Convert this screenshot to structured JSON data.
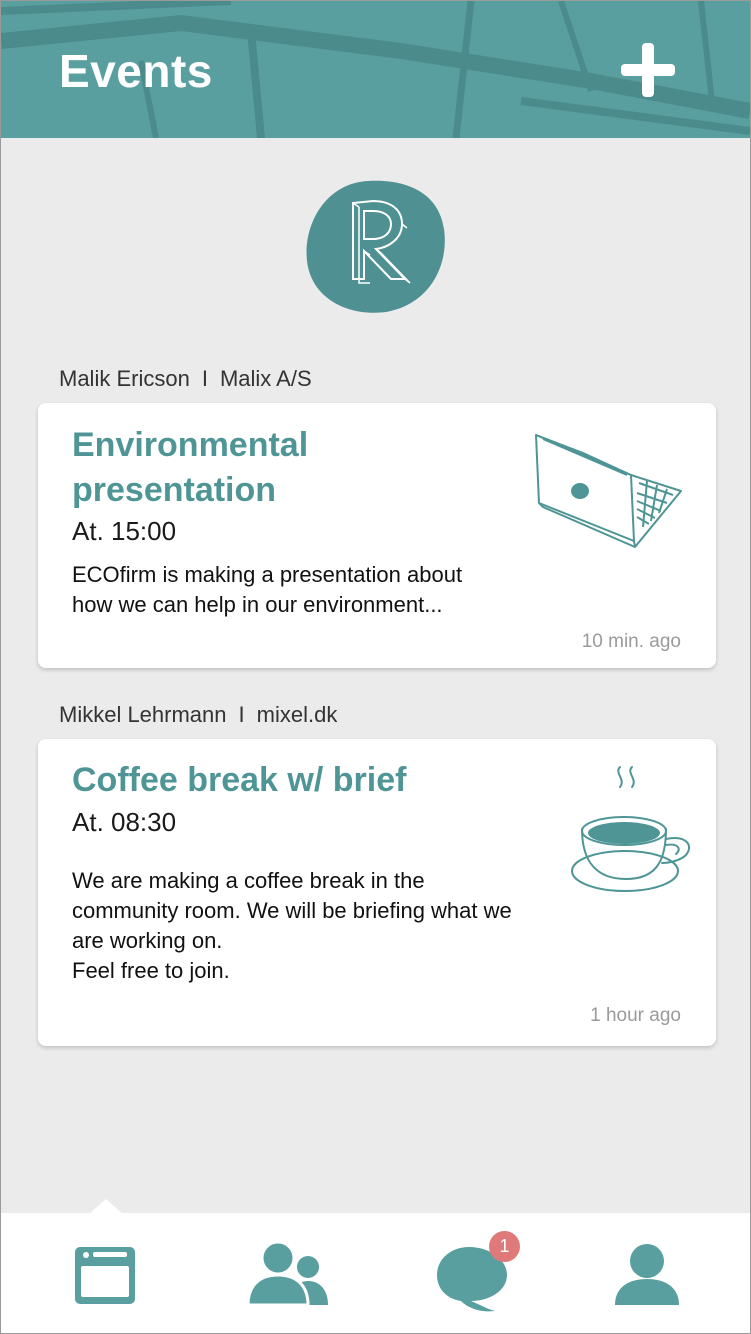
{
  "header": {
    "title": "Events",
    "add_icon": "plus-icon",
    "background": "#5a9fa0"
  },
  "logo": {
    "icon": "r-logo-icon",
    "color": "#4f9193"
  },
  "events": [
    {
      "author": "Malik Ericson",
      "separator": "I",
      "company": "Malix A/S",
      "title_line1": "Environmental",
      "title_line2": "presentation",
      "time": "At. 15:00",
      "description": "ECOfirm is making a presentation about\nhow we can help in our environment...",
      "ago": "10 min. ago",
      "icon": "laptop-icon"
    },
    {
      "author": "Mikkel Lehrmann",
      "separator": "I",
      "company": "mixel.dk",
      "title": "Coffee break w/ brief",
      "time": "At. 08:30",
      "description": "We are making a coffee break in the\ncommunity room. We will be briefing what we\nare working on.\nFeel free to join.",
      "ago": "1 hour ago",
      "icon": "coffee-cup-icon"
    }
  ],
  "tabbar": {
    "tabs": [
      {
        "name": "events",
        "icon": "events-icon",
        "active": true
      },
      {
        "name": "people",
        "icon": "people-icon",
        "active": false
      },
      {
        "name": "messages",
        "icon": "chat-icon",
        "active": false
      },
      {
        "name": "profile",
        "icon": "profile-icon",
        "active": false
      }
    ],
    "messages_badge": "1",
    "accent": "#5a9fa0",
    "badge_color": "#e07a7a"
  }
}
